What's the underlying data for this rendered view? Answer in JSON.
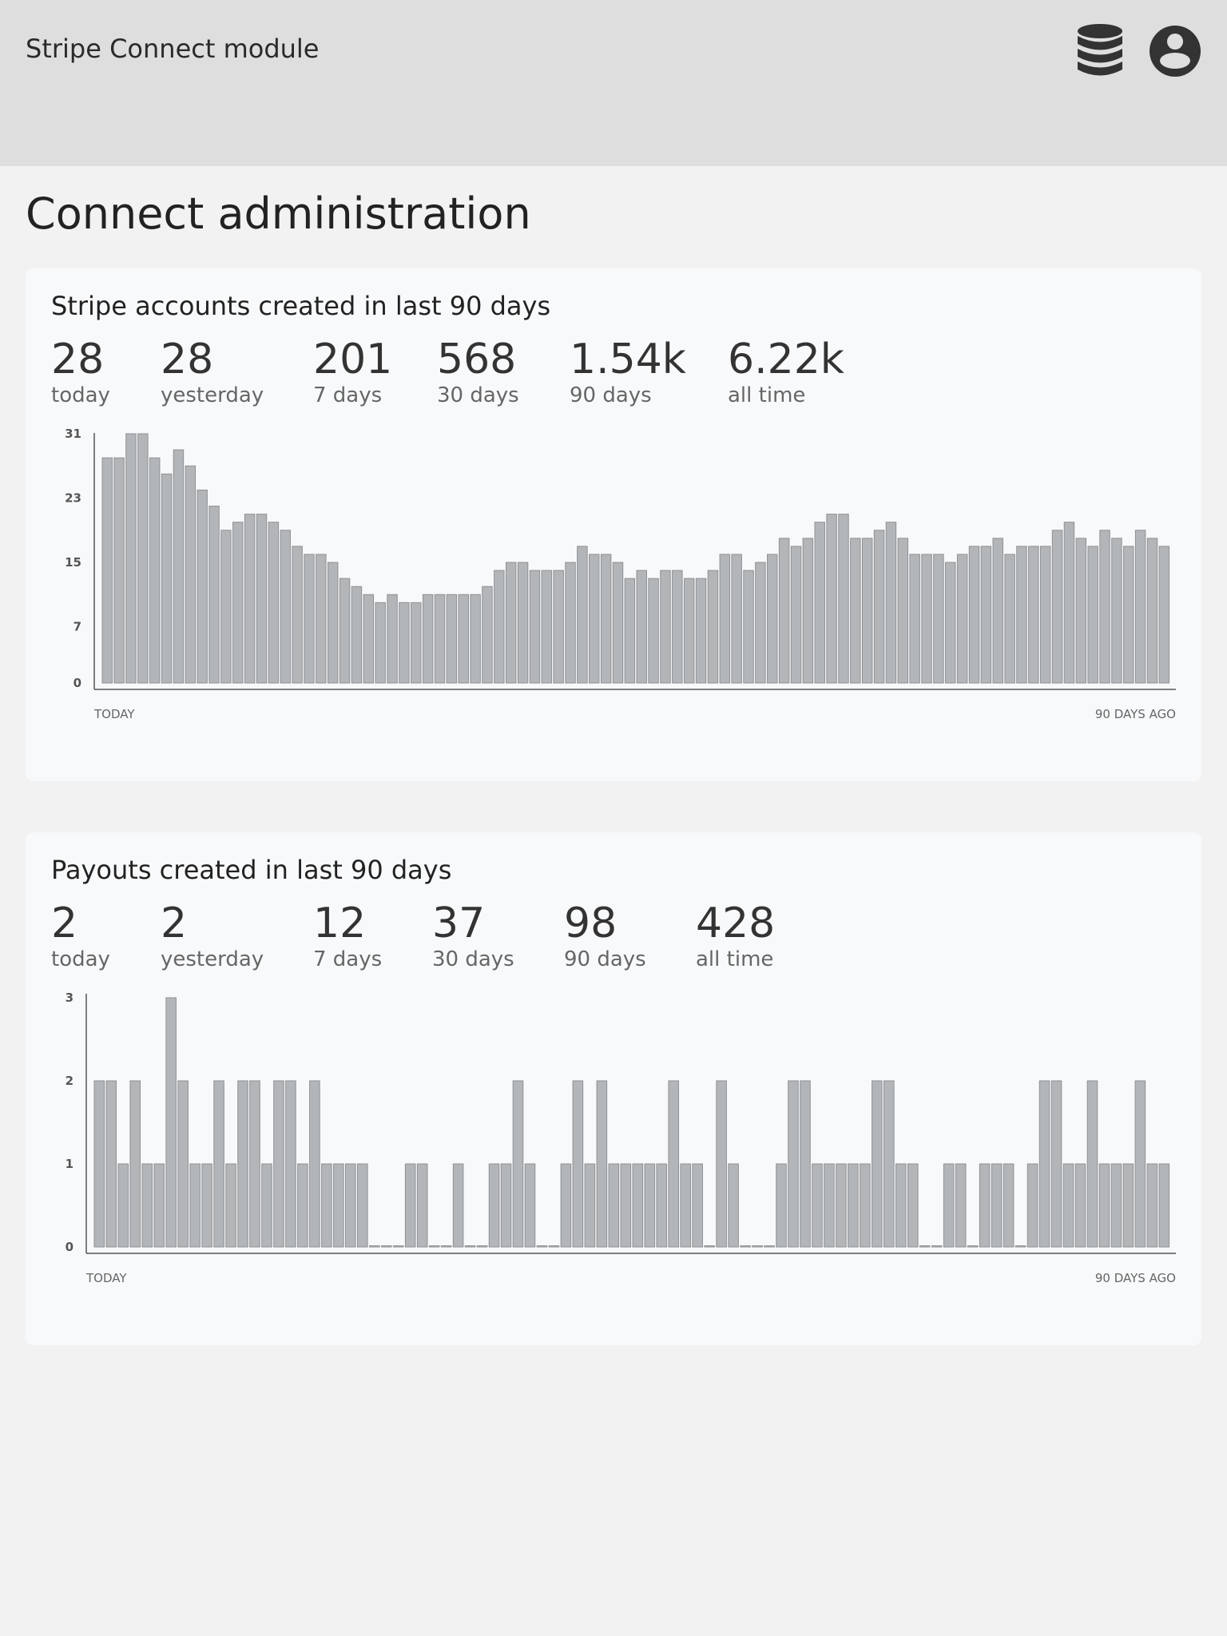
{
  "header": {
    "app_title": "Stripe Connect module",
    "icons": [
      "database-icon",
      "account-icon"
    ]
  },
  "page": {
    "title": "Connect administration"
  },
  "colors": {
    "bar": "#b3b6b9",
    "bar_stroke": "#8e9194",
    "axis": "#555555",
    "header_bg": "#dedede"
  },
  "cards": [
    {
      "title": "Stripe accounts created in last 90 days",
      "stats": [
        {
          "value": "28",
          "label": "today"
        },
        {
          "value": "28",
          "label": "yesterday"
        },
        {
          "value": "201",
          "label": "7 days"
        },
        {
          "value": "568",
          "label": "30 days"
        },
        {
          "value": "1.54k",
          "label": "90 days"
        },
        {
          "value": "6.22k",
          "label": "all time"
        }
      ]
    },
    {
      "title": "Payouts created in last 90 days",
      "stats": [
        {
          "value": "2",
          "label": "today"
        },
        {
          "value": "2",
          "label": "yesterday"
        },
        {
          "value": "12",
          "label": "7 days"
        },
        {
          "value": "37",
          "label": "30 days"
        },
        {
          "value": "98",
          "label": "90 days"
        },
        {
          "value": "428",
          "label": "all time"
        }
      ]
    }
  ],
  "chart_data": [
    {
      "type": "bar",
      "y_ticks": [
        "0",
        "7",
        "15",
        "23",
        "31"
      ],
      "ylim": [
        0,
        31
      ],
      "x_start_label": "TODAY",
      "x_end_label": "90 DAYS AGO",
      "values": [
        28,
        28,
        31,
        31,
        28,
        26,
        29,
        27,
        24,
        22,
        19,
        20,
        21,
        21,
        20,
        19,
        17,
        16,
        16,
        15,
        13,
        12,
        11,
        10,
        11,
        10,
        10,
        11,
        11,
        11,
        11,
        11,
        12,
        14,
        15,
        15,
        14,
        14,
        14,
        15,
        17,
        16,
        16,
        15,
        13,
        14,
        13,
        14,
        14,
        13,
        13,
        14,
        16,
        16,
        14,
        15,
        16,
        18,
        17,
        18,
        20,
        21,
        21,
        18,
        18,
        19,
        20,
        18,
        16,
        16,
        16,
        15,
        16,
        17,
        17,
        18,
        16,
        17,
        17,
        17,
        19,
        20,
        18,
        17,
        19,
        18,
        17,
        19,
        18,
        17
      ]
    },
    {
      "type": "bar",
      "y_ticks": [
        "0",
        "1",
        "2",
        "3"
      ],
      "ylim": [
        0,
        3
      ],
      "x_start_label": "TODAY",
      "x_end_label": "90 DAYS AGO",
      "values": [
        2,
        2,
        1,
        2,
        1,
        1,
        3,
        2,
        1,
        1,
        2,
        1,
        2,
        2,
        1,
        2,
        2,
        1,
        2,
        1,
        1,
        1,
        1,
        0,
        0,
        0,
        1,
        1,
        0,
        0,
        1,
        0,
        0,
        1,
        1,
        2,
        1,
        0,
        0,
        1,
        2,
        1,
        2,
        1,
        1,
        1,
        1,
        1,
        2,
        1,
        1,
        0,
        2,
        1,
        0,
        0,
        0,
        1,
        2,
        2,
        1,
        1,
        1,
        1,
        1,
        2,
        2,
        1,
        1,
        0,
        0,
        1,
        1,
        0,
        1,
        1,
        1,
        0,
        1,
        2,
        2,
        1,
        1,
        2,
        1,
        1,
        1,
        2,
        1,
        1
      ]
    }
  ]
}
